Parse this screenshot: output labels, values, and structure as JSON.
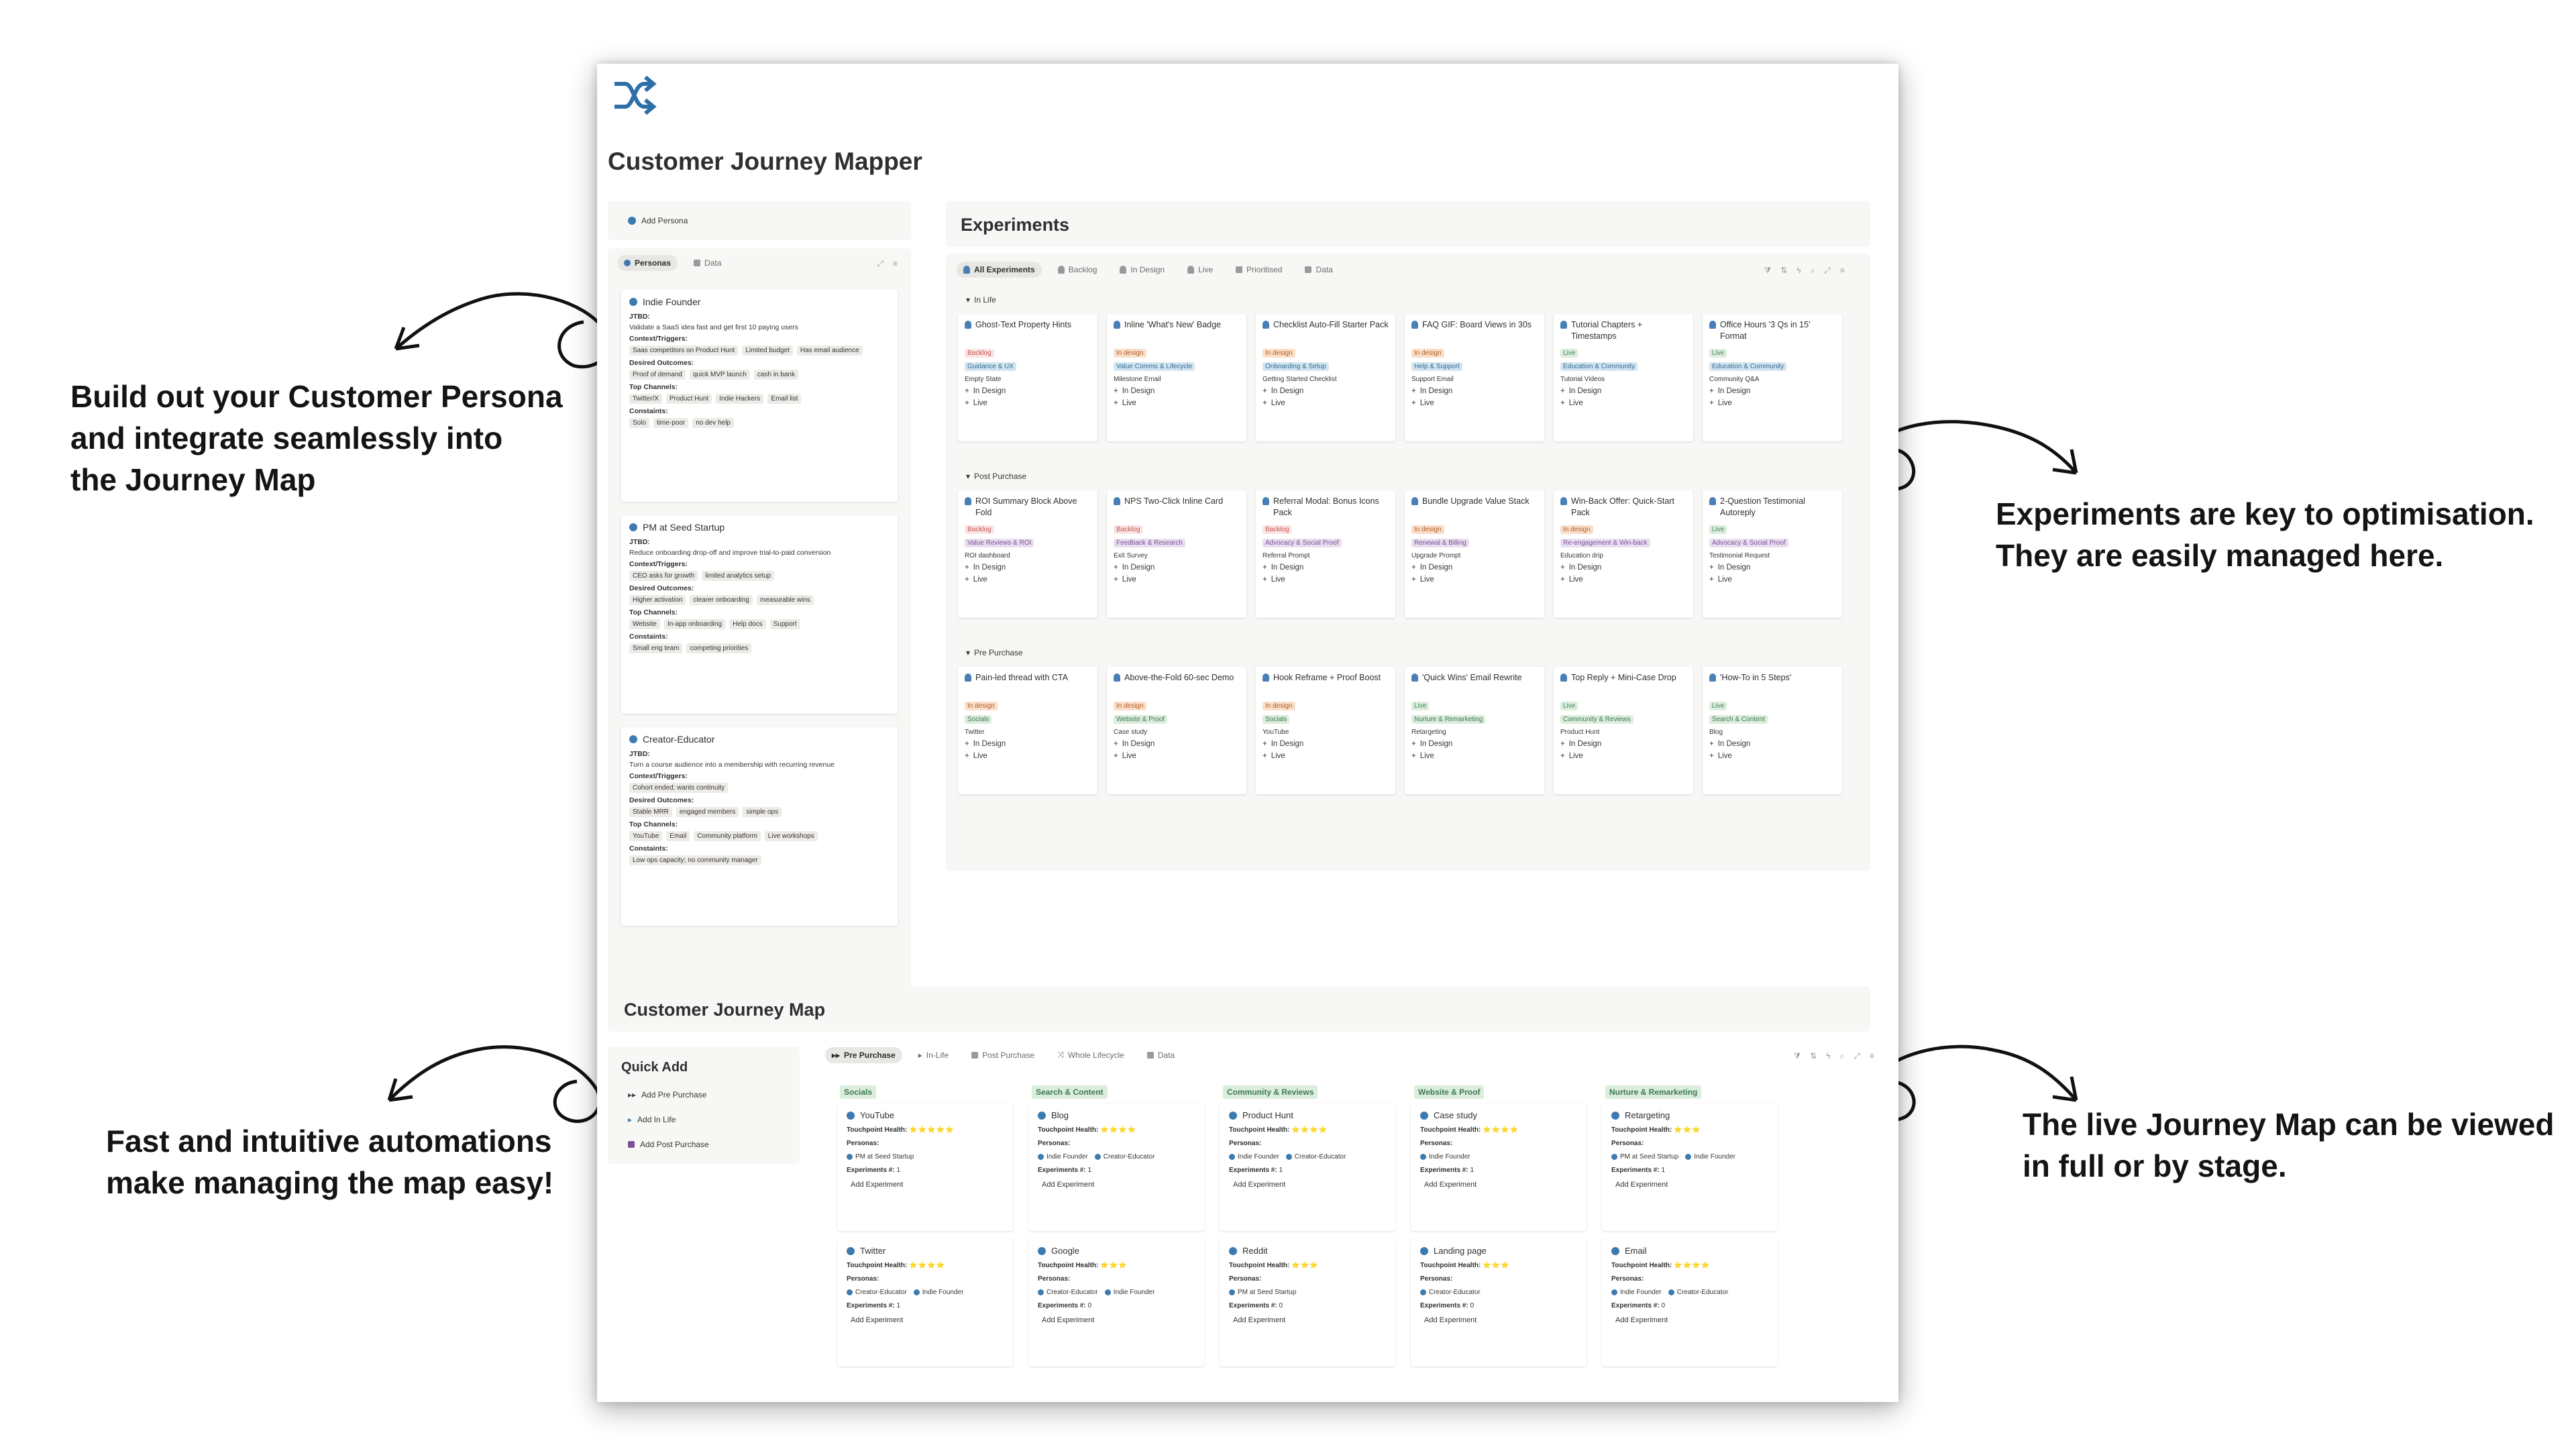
{
  "callouts": [
    {
      "lines": [
        "Build out your Customer Persona",
        "and integrate seamlessly into",
        "the Journey Map"
      ]
    },
    {
      "lines": [
        "Experiments are key to optimisation.",
        "They are easily managed here."
      ]
    },
    {
      "lines": [
        "Fast and intuitive automations",
        "make managing the map easy!"
      ]
    },
    {
      "lines": [
        "The live Journey Map can be viewed",
        "in full or by stage."
      ]
    }
  ],
  "page": {
    "title": "Customer Journey Mapper",
    "logo_icon": "shuffle-icon",
    "accent": "#2e6fa7"
  },
  "persona_panel": {
    "add_label": "Add Persona",
    "tabs": [
      {
        "label": "Personas"
      },
      {
        "label": "Data"
      }
    ],
    "labels": {
      "jtbd": "JTBD:",
      "context": "Context/Triggers:",
      "outcomes": "Desired Outcomes:",
      "channels": "Top Channels:",
      "constraints": "Constaints:"
    },
    "personas": [
      {
        "name": "Indie Founder",
        "jtbd": "Validate a SaaS idea fast and get first 10 paying users",
        "context": [
          "Saas competitors on Product Hunt",
          "Limited budget",
          "Has email audience"
        ],
        "outcomes": [
          "Proof of demand",
          "quick MVP launch",
          "cash in bank"
        ],
        "channels": [
          "Twitter/X",
          "Product Hunt",
          "Indie Hackers",
          "Email list"
        ],
        "constraints": [
          "Solo",
          "time-poor",
          "no dev help"
        ]
      },
      {
        "name": "PM at Seed Startup",
        "jtbd": "Reduce onboarding drop-off and improve trial-to-paid conversion",
        "context": [
          "CEO asks for growth",
          "limited analytics setup"
        ],
        "outcomes": [
          "Higher activation",
          "clearer onboarding",
          "measurable wins"
        ],
        "channels": [
          "Website",
          "In-app onboarding",
          "Help docs",
          "Support"
        ],
        "constraints": [
          "Small eng team",
          "competing priorities"
        ]
      },
      {
        "name": "Creator-Educator",
        "jtbd": "Turn a course audience into a membership with recurring revenue",
        "context": [
          "Cohort ended; wants continuity"
        ],
        "outcomes": [
          "Stable MRR",
          "engaged members",
          "simple ops"
        ],
        "channels": [
          "YouTube",
          "Email",
          "Community platform",
          "Live workshops"
        ],
        "constraints": [
          "Low ops capacity; no community manager"
        ]
      }
    ]
  },
  "experiments": {
    "heading": "Experiments",
    "tabs": [
      {
        "label": "All Experiments"
      },
      {
        "label": "Backlog"
      },
      {
        "label": "In Design"
      },
      {
        "label": "Live"
      },
      {
        "label": "Prioritised"
      },
      {
        "label": "Data"
      }
    ],
    "action_in_design": "In Design",
    "action_live": "Live",
    "groups": [
      {
        "label": "In Life",
        "cards": [
          {
            "title": "Ghost-Text Property Hints",
            "status": "Backlog",
            "category": "Guidance & UX",
            "sub": "Empty State"
          },
          {
            "title": "Inline 'What's New' Badge",
            "status": "In design",
            "category": "Value Comms & Lifecycle",
            "sub": "Milestone Email"
          },
          {
            "title": "Checklist Auto-Fill Starter Pack",
            "status": "In design",
            "category": "Onboarding & Setup",
            "sub": "Getting Started Checklist"
          },
          {
            "title": "FAQ GIF: Board Views in 30s",
            "status": "In design",
            "category": "Help & Support",
            "sub": "Support Email"
          },
          {
            "title": "Tutorial Chapters + Timestamps",
            "status": "Live",
            "category": "Education & Community",
            "sub": "Tutorial Videos"
          },
          {
            "title": "Office Hours '3 Qs in 15' Format",
            "status": "Live",
            "category": "Education & Community",
            "sub": "Community Q&A"
          }
        ]
      },
      {
        "label": "Post Purchase",
        "cards": [
          {
            "title": "ROI Summary Block Above Fold",
            "status": "Backlog",
            "category": "Value Reviews & ROI",
            "sub": "ROI dashboard"
          },
          {
            "title": "NPS Two-Click Inline Card",
            "status": "Backlog",
            "category": "Feedback & Research",
            "sub": "Exit Survey"
          },
          {
            "title": "Referral Modal: Bonus Icons Pack",
            "status": "Backlog",
            "category": "Advocacy & Social Proof",
            "sub": "Referral Prompt"
          },
          {
            "title": "Bundle Upgrade Value Stack",
            "status": "In design",
            "category": "Renewal & Billing",
            "sub": "Upgrade Prompt"
          },
          {
            "title": "Win-Back Offer: Quick-Start Pack",
            "status": "In design",
            "category": "Re-engagement & Win-back",
            "sub": "Education drip"
          },
          {
            "title": "2-Question Testimonial Autoreply",
            "status": "Live",
            "category": "Advocacy & Social Proof",
            "sub": "Testimonial Request"
          }
        ]
      },
      {
        "label": "Pre Purchase",
        "cards": [
          {
            "title": "Pain-led thread with CTA",
            "status": "In design",
            "category": "Socials",
            "sub": "Twitter"
          },
          {
            "title": "Above-the-Fold 60-sec Demo",
            "status": "In design",
            "category": "Website & Proof",
            "sub": "Case study"
          },
          {
            "title": "Hook Reframe + Proof Boost",
            "status": "In design",
            "category": "Socials",
            "sub": "YouTube"
          },
          {
            "title": "'Quick Wins' Email Rewrite",
            "status": "Live",
            "category": "Nurture & Remarketing",
            "sub": "Retargeting"
          },
          {
            "title": "Top Reply + Mini-Case Drop",
            "status": "Live",
            "category": "Community & Reviews",
            "sub": "Product Hunt"
          },
          {
            "title": "'How-To in 5 Steps'",
            "status": "Live",
            "category": "Search & Content",
            "sub": "Blog"
          }
        ]
      }
    ]
  },
  "journey_map": {
    "heading": "Customer Journey Map",
    "quick_add": {
      "title": "Quick Add",
      "items": [
        {
          "label": "Add Pre Purchase"
        },
        {
          "label": "Add In Life"
        },
        {
          "label": "Add Post Purchase"
        }
      ]
    },
    "tabs": [
      {
        "label": "Pre Purchase"
      },
      {
        "label": "In-Life"
      },
      {
        "label": "Post Purchase"
      },
      {
        "label": "Whole Lifecycle"
      },
      {
        "label": "Data"
      }
    ],
    "labels": {
      "health": "Touchpoint Health:",
      "personas": "Personas:",
      "experiments": "Experiments #:",
      "add": "Add Experiment"
    },
    "columns": [
      {
        "label": "Socials",
        "cards": [
          {
            "name": "YouTube",
            "stars": "⭐⭐⭐⭐⭐",
            "personas": [
              "PM at Seed Startup"
            ],
            "experiments": "1"
          },
          {
            "name": "Twitter",
            "stars": "⭐⭐⭐⭐",
            "personas": [
              "Creator-Educator",
              "Indie Founder"
            ],
            "experiments": "1"
          }
        ]
      },
      {
        "label": "Search & Content",
        "cards": [
          {
            "name": "Blog",
            "stars": "⭐⭐⭐⭐",
            "personas": [
              "Indie Founder",
              "Creator-Educator"
            ],
            "experiments": "1"
          },
          {
            "name": "Google",
            "stars": "⭐⭐⭐",
            "personas": [
              "Creator-Educator",
              "Indie Founder"
            ],
            "experiments": "0"
          }
        ]
      },
      {
        "label": "Community & Reviews",
        "cards": [
          {
            "name": "Product Hunt",
            "stars": "⭐⭐⭐⭐",
            "personas": [
              "Indie Founder",
              "Creator-Educator"
            ],
            "experiments": "1"
          },
          {
            "name": "Reddit",
            "stars": "⭐⭐⭐",
            "personas": [
              "PM at Seed Startup"
            ],
            "experiments": "0"
          }
        ]
      },
      {
        "label": "Website & Proof",
        "cards": [
          {
            "name": "Case study",
            "stars": "⭐⭐⭐⭐",
            "personas": [
              "Indie Founder"
            ],
            "experiments": "1"
          },
          {
            "name": "Landing page",
            "stars": "⭐⭐⭐",
            "personas": [
              "Creator-Educator"
            ],
            "experiments": "0"
          }
        ]
      },
      {
        "label": "Nurture & Remarketing",
        "cards": [
          {
            "name": "Retargeting",
            "stars": "⭐⭐⭐",
            "personas": [
              "PM at Seed Startup",
              "Indie Founder"
            ],
            "experiments": "1"
          },
          {
            "name": "Email",
            "stars": "⭐⭐⭐⭐",
            "personas": [
              "Indie Founder",
              "Creator-Educator"
            ],
            "experiments": "0"
          }
        ]
      }
    ]
  },
  "colors": {
    "backlog": "#c4554d",
    "in_design": "#b35f26",
    "live": "#448361"
  }
}
